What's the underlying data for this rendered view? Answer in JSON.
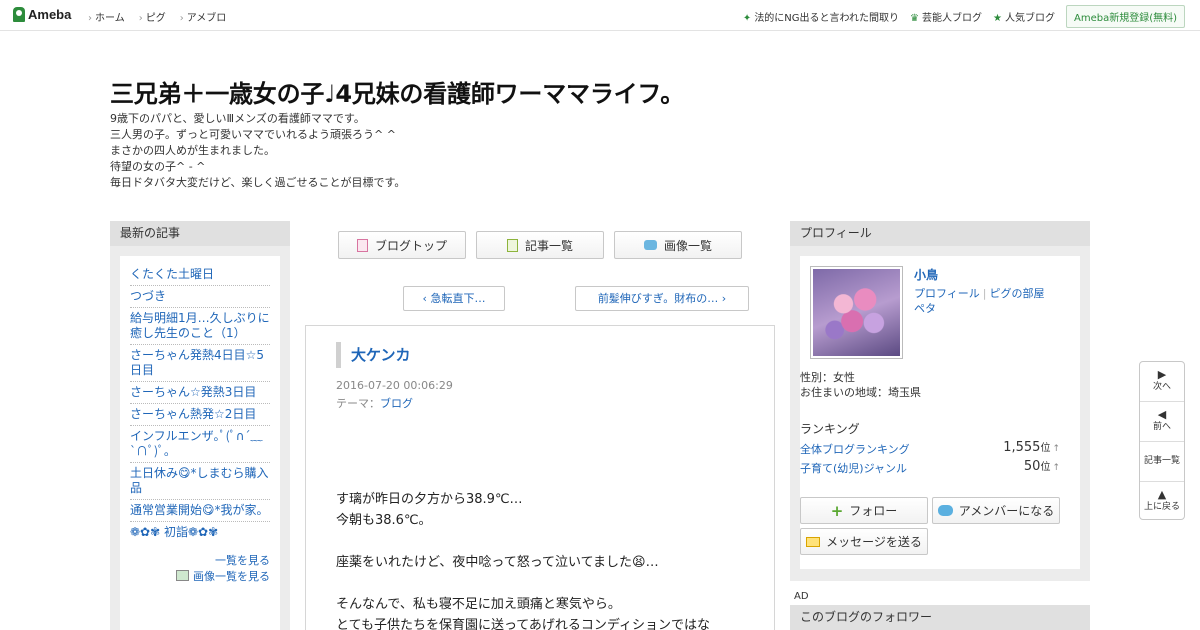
{
  "topbar": {
    "logo": "Ameba",
    "nav": [
      "ホーム",
      "ピグ",
      "アメブロ"
    ],
    "right": [
      {
        "icon": "sparkle-icon",
        "label": "法的にNG出ると言われた間取り"
      },
      {
        "icon": "crown-icon",
        "label": "芸能人ブログ"
      },
      {
        "icon": "star-icon",
        "label": "人気ブログ"
      }
    ],
    "signup": "Ameba新規登録(無料)"
  },
  "header": {
    "title": "三兄弟＋一歳女の子♩4兄妹の看護師ワーママライフ。",
    "description": "9歳下のパパと、愛しいⅢメンズの看護師ママです。\n三人男の子。ずっと可愛いママでいれるよう頑張ろう^ ^\nまさかの四人めが生まれました。\n待望の女の子^ - ^\n毎日ドタバタ大変だけど、楽しく過ごせることが目標です。"
  },
  "sidebar_left": {
    "heading": "最新の記事",
    "entries": [
      "くたくた土曜日",
      "つづき",
      "給与明細1月…久しぶりに癒し先生のこと（1）",
      "さーちゃん発熱4日目☆5日目",
      "さーちゃん☆発熱3日目",
      "さーちゃん熱発☆2日目",
      "インフルエンザ｡ﾟ(ﾟ∩´﹏`∩ﾟ)ﾟ｡",
      "土日休み😋*しまむら購入品",
      "通常営業開始😋*我が家。",
      "❁✿✾ 初詣❁✿✾"
    ],
    "more": "一覧を見る",
    "more_images": "画像一覧を見る"
  },
  "center": {
    "buttons": [
      "ブログトップ",
      "記事一覧",
      "画像一覧"
    ],
    "prev": "急転直下…",
    "next": "前髪伸びすぎ。財布の…",
    "article": {
      "title": "大ケンカ",
      "date": "2016-07-20 00:06:29",
      "theme_label": "テーマ：",
      "theme": "ブログ",
      "body": "す璃が昨日の夕方から38.9℃…\n今朝も38.6℃。\n\n座薬をいれたけど、夜中唸って怒って泣いてました😫…\n\nそんなんで、私も寝不足に加え頭痛と寒気やら。\nとても子供たちを保育園に送ってあげれるコンディションではな"
    }
  },
  "profile": {
    "heading": "プロフィール",
    "name": "小鳥",
    "links": [
      "プロフィール",
      "ピグの部屋",
      "ペタ"
    ],
    "gender": "性別：女性",
    "region": "お住まいの地域：埼玉県",
    "ranking_heading": "ランキング",
    "rankings": [
      {
        "label": "全体ブログランキング",
        "value": "1,555",
        "unit": "位",
        "trend": "↑"
      },
      {
        "label": "子育て(幼児)ジャンル",
        "value": "50",
        "unit": "位",
        "trend": "↑"
      }
    ],
    "follow": "フォロー",
    "amember": "アメンバーになる",
    "message": "メッセージを送る"
  },
  "ad_label": "AD",
  "followers_heading": "このブログのフォロワー",
  "sidenav": {
    "next": "次へ",
    "prev": "前へ",
    "list": "記事一覧",
    "top": "上に戻る"
  }
}
